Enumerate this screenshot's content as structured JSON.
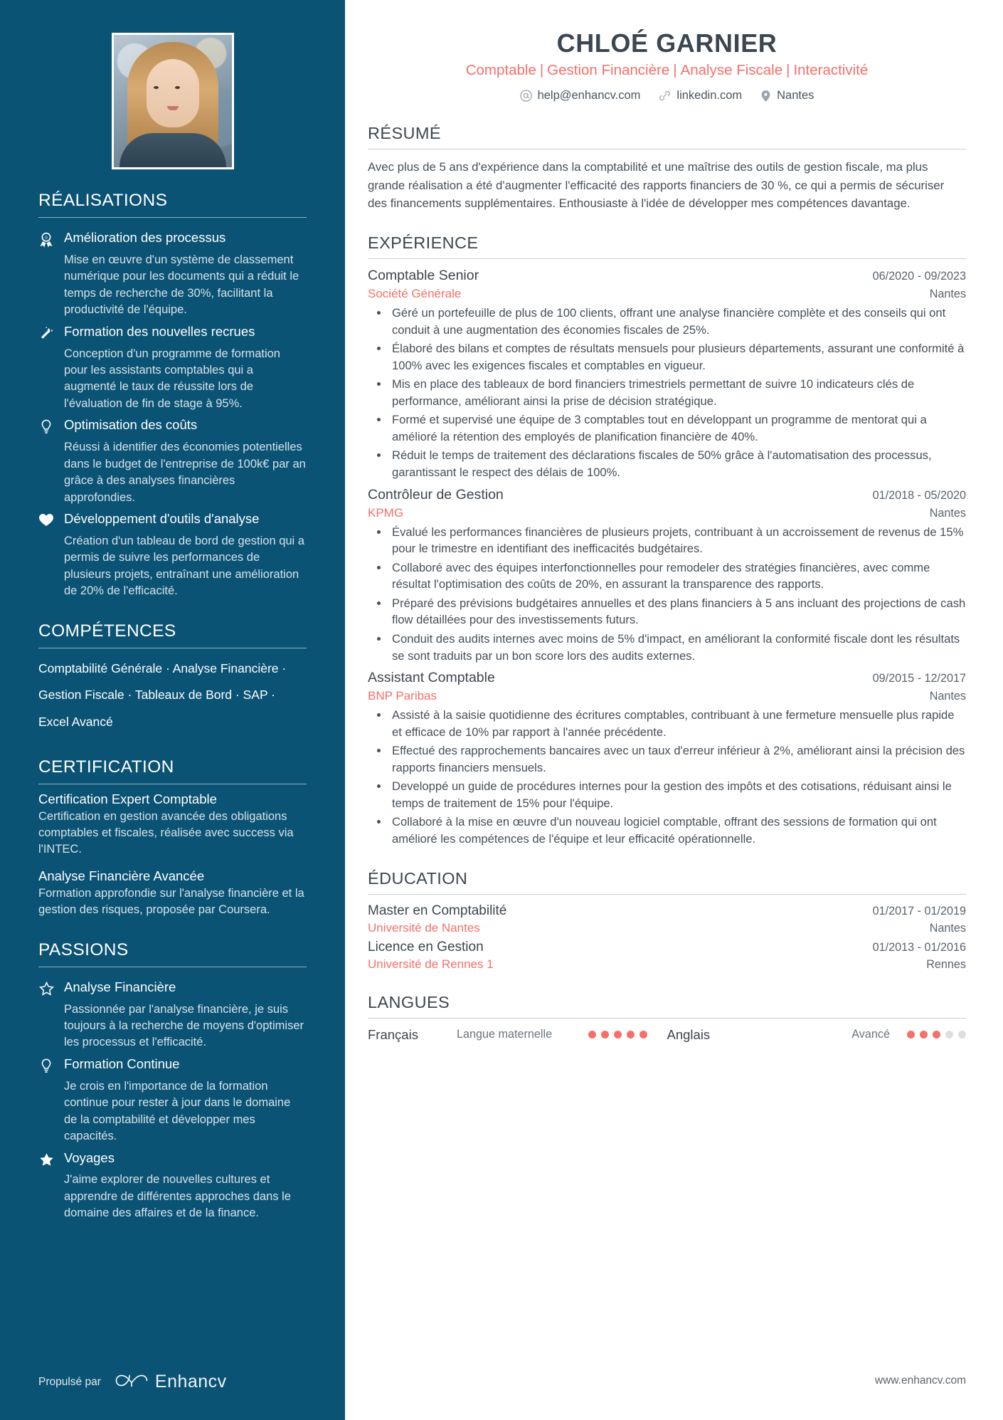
{
  "accent_coral": "#f4706a",
  "sidebar_bg": "#0b5374",
  "header": {
    "name": "CHLOÉ GARNIER",
    "headline_parts": [
      "Comptable",
      "Gestion Financière",
      "Analyse Fiscale",
      "Interactivité"
    ],
    "headline_separator": "|",
    "contacts": [
      {
        "icon": "email-icon",
        "text": "help@enhancv.com"
      },
      {
        "icon": "link-icon",
        "text": "linkedin.com"
      },
      {
        "icon": "location-pin-icon",
        "text": "Nantes"
      }
    ]
  },
  "sidebar": {
    "achievements": {
      "heading": "RÉALISATIONS",
      "items": [
        {
          "icon": "award-ribbon-icon",
          "title": "Amélioration des processus",
          "desc": "Mise en œuvre d'un système de classement numérique pour les documents qui a réduit le temps de recherche de 30%, facilitant la productivité de l'équipe."
        },
        {
          "icon": "magic-wand-icon",
          "title": "Formation des nouvelles recrues",
          "desc": "Conception d'un programme de formation pour les assistants comptables qui a augmenté le taux de réussite lors de l'évaluation de fin de stage à 95%."
        },
        {
          "icon": "lightbulb-icon",
          "title": "Optimisation des coûts",
          "desc": "Réussi à identifier des économies potentielles dans le budget de l'entreprise de 100k€ par an grâce à des analyses financières approfondies."
        },
        {
          "icon": "heart-icon",
          "title": "Développement d'outils d'analyse",
          "desc": "Création d'un tableau de bord de gestion qui a permis de suivre les performances de plusieurs projets, entraînant une amélioration de 20% de l'efficacité."
        }
      ]
    },
    "skills": {
      "heading": "COMPÉTENCES",
      "lines": [
        "Comptabilité Générale · Analyse Financière ·",
        "Gestion Fiscale · Tableaux de Bord · SAP ·",
        "Excel Avancé"
      ]
    },
    "certification": {
      "heading": "CERTIFICATION",
      "items": [
        {
          "title": "Certification Expert Comptable",
          "desc": "Certification en gestion avancée des obligations comptables et fiscales, réalisée avec success via l'INTEC."
        },
        {
          "title": "Analyse Financière Avancée",
          "desc": "Formation approfondie sur l'analyse financière et la gestion des risques, proposée par Coursera."
        }
      ]
    },
    "passions": {
      "heading": "PASSIONS",
      "items": [
        {
          "icon": "star-outline-icon",
          "title": "Analyse Financière",
          "desc": "Passionnée par l'analyse financière, je suis toujours à la recherche de moyens d'optimiser les processus et l'efficacité."
        },
        {
          "icon": "lightbulb-icon",
          "title": "Formation Continue",
          "desc": "Je crois en l'importance de la formation continue pour rester à jour dans le domaine de la comptabilité et développer mes capacités."
        },
        {
          "icon": "star-filled-icon",
          "title": "Voyages",
          "desc": "J'aime explorer de nouvelles cultures et apprendre de différentes approches dans le domaine des affaires et de la finance."
        }
      ]
    },
    "footer": {
      "powered_by": "Propulsé par",
      "brand": "Enhancv",
      "brand_icon": "enhancv-logo-icon"
    }
  },
  "main": {
    "summary": {
      "heading": "RÉSUMÉ",
      "text": "Avec plus de 5 ans d'expérience dans la comptabilité et une maîtrise des outils de gestion fiscale, ma plus grande réalisation a été d'augmenter l'efficacité des rapports financiers de 30 %, ce qui a permis de sécuriser des financements supplémentaires. Enthousiaste à l'idée de développer mes compétences davantage."
    },
    "experience": {
      "heading": "EXPÉRIENCE",
      "jobs": [
        {
          "title": "Comptable Senior",
          "date": "06/2020 - 09/2023",
          "company": "Société Générale",
          "location": "Nantes",
          "bullets": [
            "Géré un portefeuille de plus de 100 clients, offrant une analyse financière complète et des conseils qui ont conduit à une augmentation des économies fiscales de 25%.",
            "Élaboré des bilans et comptes de résultats mensuels pour plusieurs départements, assurant une conformité à 100% avec les exigences fiscales et comptables en vigueur.",
            "Mis en place des tableaux de bord financiers trimestriels permettant de suivre 10 indicateurs clés de performance, améliorant ainsi la prise de décision stratégique.",
            "Formé et supervisé une équipe de 3 comptables tout en développant un programme de mentorat qui a amélioré la rétention des employés de planification financière de 40%.",
            "Réduit le temps de traitement des déclarations fiscales de 50% grâce à l'automatisation des processus, garantissant le respect des délais de 100%."
          ]
        },
        {
          "title": "Contrôleur de Gestion",
          "date": "01/2018 - 05/2020",
          "company": "KPMG",
          "location": "Nantes",
          "bullets": [
            "Évalué les performances financières de plusieurs projets, contribuant à un accroissement de revenus de 15% pour le trimestre en identifiant des inefficacités budgétaires.",
            "Collaboré avec des équipes interfonctionnelles pour remodeler des stratégies financières, avec comme résultat l'optimisation des coûts de 20%, en assurant la transparence des rapports.",
            "Préparé des prévisions budgétaires annuelles et des plans financiers à 5 ans incluant des projections de cash flow détaillées pour des investissements futurs.",
            "Conduit des audits internes avec moins de 5% d'impact, en améliorant la conformité fiscale dont les résultats se sont traduits par un bon score lors des audits externes."
          ]
        },
        {
          "title": "Assistant Comptable",
          "date": "09/2015 - 12/2017",
          "company": "BNP Paribas",
          "location": "Nantes",
          "bullets": [
            "Assisté à la saisie quotidienne des écritures comptables, contribuant à une fermeture mensuelle plus rapide et efficace de 10% par rapport à l'année précédente.",
            "Effectué des rapprochements bancaires avec un taux d'erreur inférieur à 2%, améliorant ainsi la précision des rapports financiers mensuels.",
            "Developpé un guide de procédures internes pour la gestion des impôts et des cotisations, réduisant ainsi le temps de traitement de 15% pour l'équipe.",
            "Collaboré à la mise en œuvre d'un nouveau logiciel comptable, offrant des sessions de formation qui ont amélioré les compétences de l'équipe et leur efficacité opérationnelle."
          ]
        }
      ]
    },
    "education": {
      "heading": "ÉDUCATION",
      "items": [
        {
          "title": "Master en Comptabilité",
          "date": "01/2017 - 01/2019",
          "school": "Université de Nantes",
          "location": "Nantes"
        },
        {
          "title": "Licence en Gestion",
          "date": "01/2013 - 01/2016",
          "school": "Université de Rennes 1",
          "location": "Rennes"
        }
      ]
    },
    "languages": {
      "heading": "LANGUES",
      "items": [
        {
          "name": "Français",
          "level": "Langue maternelle",
          "filled": 5,
          "total": 5
        },
        {
          "name": "Anglais",
          "level": "Avancé",
          "filled": 3,
          "total": 5
        }
      ]
    },
    "footer_url": "www.enhancv.com"
  }
}
